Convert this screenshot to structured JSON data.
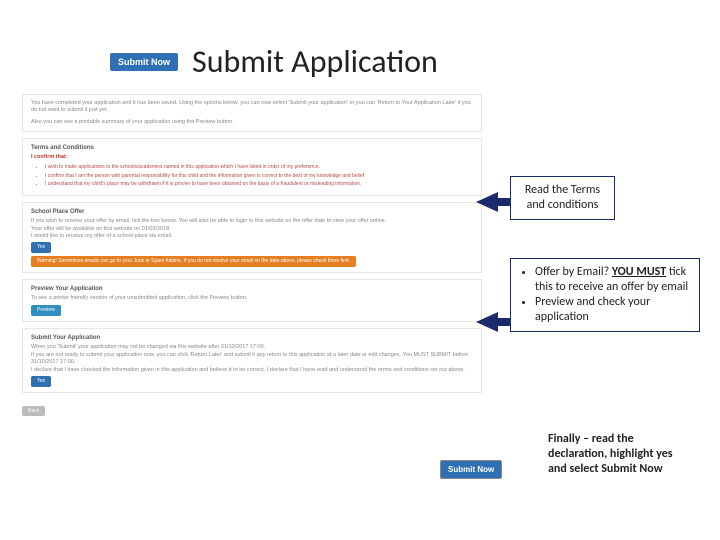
{
  "header": {
    "submit_button_label": "Submit Now",
    "title": "Submit Application"
  },
  "panels": {
    "intro": {
      "line1": "You have completed your application and it has been saved. Using the options below, you can now select 'Submit your application' or you can 'Return to Your Application Later' if you do not want to submit it just yet.",
      "line2": "Also you can see a printable summary of your application using the Preview button."
    },
    "terms": {
      "heading": "Terms and Conditions",
      "confirm": "I confirm that:",
      "items": [
        "I wish to make applications to the schools/academies named in this application which I have listed in order of my preference.",
        "I confirm that I am the person with parental responsibility for this child and the information given is correct to the best of my knowledge and belief.",
        "I understand that my child's place may be withdrawn if it is proven to have been obtained on the basis of a fraudulent or misleading information."
      ]
    },
    "offer": {
      "heading": "School Place Offer",
      "line1": "If you wish to receive your offer by email, tick the box below. You will also be able to login to this website on the offer date to view your offer online.",
      "line2": "Your offer will be available on this website on 01/03/2018.",
      "line3": "I would like to receive my offer of a school place via email.",
      "toggle": "Yes",
      "warn": "Warning! Sometimes emails can go to your Junk or Spam folders. If you do not receive your email on the date above, please check there first."
    },
    "preview": {
      "heading": "Preview Your Application",
      "line": "To see a printer friendly version of your unsubmitted application, click the Preview button.",
      "btn": "Preview"
    },
    "submit": {
      "heading": "Submit Your Application",
      "line1": "When you 'Submit' your application may not be changed via this website after 31/10/2017 17:00.",
      "line2": "If you are not ready to submit your application now, you can click 'Return Later' and submit it any return to this application at a later date or edit changes. You MUST SUBMIT before 31/10/2017 17:00.",
      "line3": "I declare that I have checked the information given in this application and believe it to be correct. I declare that I have read and understood the terms and conditions set out above.",
      "toggle": "Yes",
      "back": "Back"
    }
  },
  "callouts": {
    "c1": "Read the Terms and conditions",
    "c2": {
      "b1_pre": "Offer by Email? ",
      "b1_em": "YOU MUST",
      "b1_post": " tick this to receive an offer by email",
      "b2": "Preview and check your application"
    },
    "c3": "Finally – read the declaration, highlight yes and select Submit Now"
  },
  "footer": {
    "submit_now": "Submit Now"
  }
}
